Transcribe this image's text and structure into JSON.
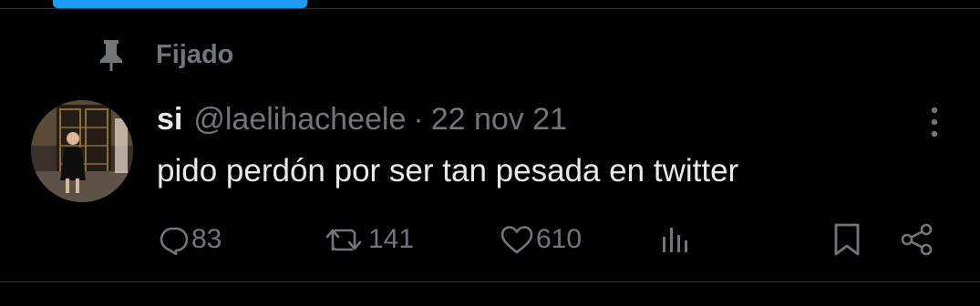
{
  "pinned": {
    "label": "Fijado",
    "icon": "pin-icon"
  },
  "tweet": {
    "author_name": "si",
    "handle": "@laelihacheele",
    "separator": "·",
    "date": "22 nov 21",
    "text": "pido perdón por ser tan pesada en twitter"
  },
  "actions": {
    "replies": "83",
    "retweets": "141",
    "likes": "610"
  },
  "icons": [
    "pin-icon",
    "more-icon",
    "reply-icon",
    "retweet-icon",
    "like-icon",
    "views-icon",
    "bookmark-icon",
    "share-icon"
  ],
  "colors": {
    "background": "#000000",
    "text": "#e7e9ea",
    "secondary": "#71767b",
    "accent": "#1d9bf0",
    "divider": "#2f3336"
  }
}
